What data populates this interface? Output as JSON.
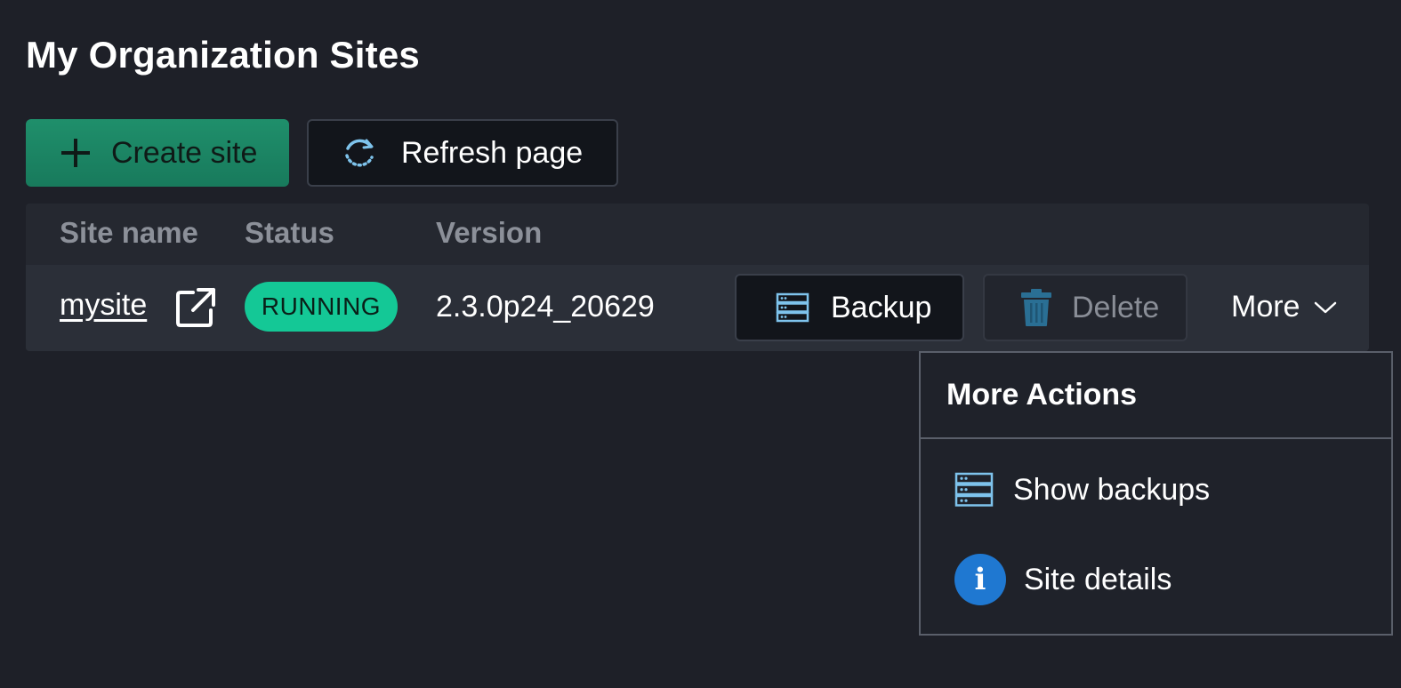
{
  "page": {
    "title": "My Organization Sites"
  },
  "toolbar": {
    "create_label": "Create site",
    "refresh_label": "Refresh page"
  },
  "table": {
    "columns": [
      "Site name",
      "Status",
      "Version"
    ],
    "rows": [
      {
        "site_name": "mysite",
        "status": "RUNNING",
        "version": "2.3.0p24_20629",
        "backup_label": "Backup",
        "delete_label": "Delete",
        "more_label": "More"
      }
    ]
  },
  "more_menu": {
    "title": "More Actions",
    "items": [
      {
        "label": "Show backups",
        "icon": "database-icon"
      },
      {
        "label": "Site details",
        "icon": "info-icon"
      }
    ]
  },
  "colors": {
    "background": "#1e2028",
    "accent_green": "#1f8f6b",
    "status_running": "#14c896",
    "icon_blue": "#7ec3ec",
    "info_blue": "#1f78d1"
  }
}
